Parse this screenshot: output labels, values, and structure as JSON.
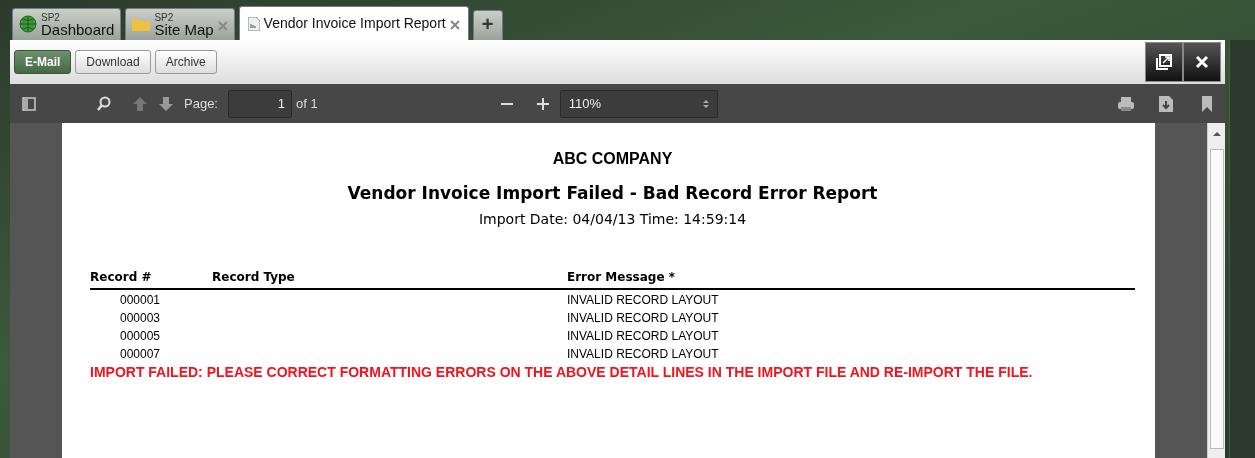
{
  "tabs": [
    {
      "group": "SP2",
      "label": "Dashboard",
      "kind": "globe",
      "closable": false,
      "selected": false
    },
    {
      "group": "SP2",
      "label": "Site Map",
      "kind": "folder",
      "closable": true,
      "selected": false
    },
    {
      "label": "Vendor Invoice Import Report",
      "kind": "report",
      "closable": true,
      "selected": true
    }
  ],
  "new_tab": "+",
  "actions": [
    {
      "label": "E-Mail",
      "selected": true
    },
    {
      "label": "Download",
      "selected": false
    },
    {
      "label": "Archive",
      "selected": false
    }
  ],
  "viewer_toolbar": {
    "page_label": "Page:",
    "page": "1",
    "page_count": "of 1",
    "zoom": "110%"
  },
  "report": {
    "company": "ABC COMPANY",
    "title": "Vendor Invoice Import Failed - Bad Record Error Report",
    "subtitle": "Import Date: 04/04/13 Time: 14:59:14",
    "columns": [
      "Record #",
      "Record Type",
      "Error Message *"
    ],
    "rows": [
      {
        "record": "000001",
        "message": "INVALID RECORD LAYOUT"
      },
      {
        "record": "000003",
        "message": "INVALID RECORD LAYOUT"
      },
      {
        "record": "000005",
        "message": "INVALID RECORD LAYOUT"
      },
      {
        "record": "000007",
        "message": "INVALID RECORD LAYOUT"
      }
    ],
    "error": "IMPORT FAILED: PLEASE CORRECT FORMATTING ERRORS ON THE ABOVE DETAIL LINES IN THE IMPORT FILE AND RE-IMPORT THE FILE."
  }
}
